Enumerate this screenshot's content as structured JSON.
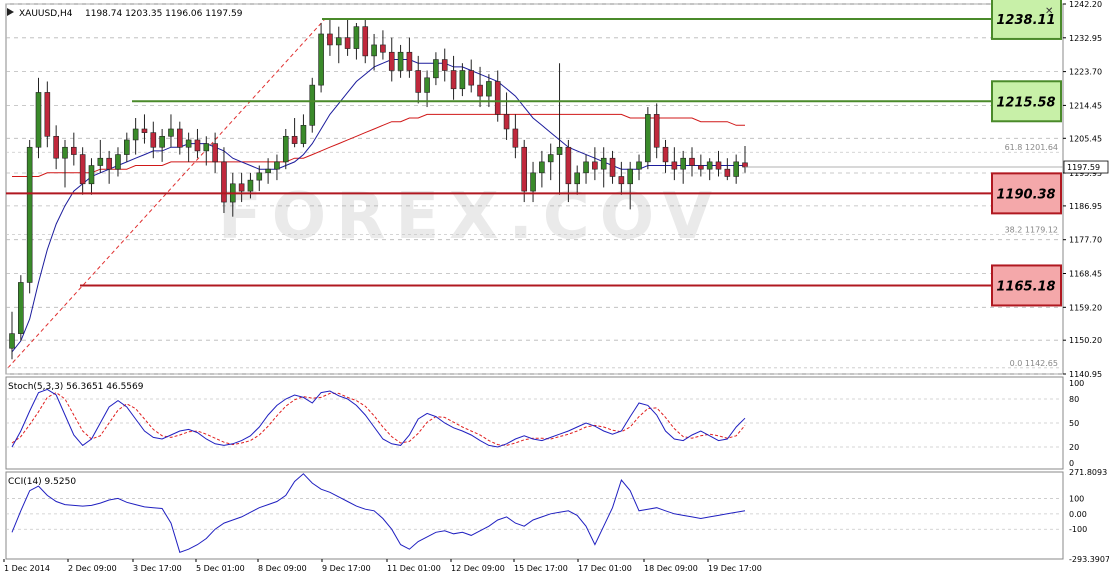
{
  "window": {
    "symbol_header": "XAUUSD,H4",
    "ohlc": "1198.74 1203.35 1196.06 1197.59",
    "close_button": "✕"
  },
  "watermark": "FOREX.COV",
  "price_axis": {
    "ticks": [
      "1242.20",
      "1232.95",
      "1223.70",
      "1214.45",
      "1205.45",
      "1195.95",
      "1186.95",
      "1177.70",
      "1168.45",
      "1159.20",
      "1150.20",
      "1140.95"
    ],
    "current_price": "1197.59"
  },
  "levels": [
    {
      "label": "1238.11",
      "value": 1238.11,
      "kind": "resistance"
    },
    {
      "label": "1215.58",
      "value": 1215.58,
      "kind": "resistance"
    },
    {
      "label": "1190.38",
      "value": 1190.38,
      "kind": "support"
    },
    {
      "label": "1165.18",
      "value": 1165.18,
      "kind": "support"
    }
  ],
  "fibo": [
    {
      "label": "61.8  1201.64",
      "value": 1201.64
    },
    {
      "label": "38.2  1179.12",
      "value": 1179.12
    },
    {
      "label": "0.0  1142.65",
      "value": 1142.65
    }
  ],
  "time_axis": [
    "1 Dec 2014",
    "2 Dec 09:00",
    "3 Dec 17:00",
    "5 Dec 01:00",
    "8 Dec 09:00",
    "9 Dec 17:00",
    "11 Dec 01:00",
    "12 Dec 09:00",
    "15 Dec 17:00",
    "17 Dec 01:00",
    "18 Dec 09:00",
    "19 Dec 17:00"
  ],
  "stoch": {
    "label": "Stoch(5,3,3) 56.3651 46.5569",
    "ticks": [
      "100",
      "80",
      "50",
      "20",
      "0"
    ]
  },
  "cci": {
    "label": "CCI(14) 9.5250",
    "ticks": [
      "271.8093",
      "100",
      "0.00",
      "-100",
      "-293.3907"
    ]
  },
  "colors": {
    "bull": "#3a8a2a",
    "bear": "#c0283c",
    "ma_fast": "#1c1c9c",
    "ma_slow": "#d01818",
    "resistance_line": "#4a8a2a",
    "resistance_fill": "#c8f0a8",
    "support_line": "#b01820",
    "support_fill": "#f4a8aa",
    "osc": "#2020c0",
    "signal": "#e02020"
  },
  "chart_data": {
    "type": "candlestick",
    "title": "XAUUSD,H4",
    "ylim": [
      1140.95,
      1242.2
    ],
    "candles": [
      [
        1148,
        1158,
        1145,
        1152
      ],
      [
        1152,
        1168,
        1150,
        1166
      ],
      [
        1166,
        1205,
        1163,
        1203
      ],
      [
        1203,
        1222,
        1200,
        1218
      ],
      [
        1218,
        1221,
        1203,
        1206
      ],
      [
        1206,
        1209,
        1197,
        1200
      ],
      [
        1200,
        1205,
        1192,
        1203
      ],
      [
        1203,
        1207,
        1198,
        1201
      ],
      [
        1201,
        1203,
        1190,
        1193
      ],
      [
        1193,
        1200,
        1190,
        1198
      ],
      [
        1198,
        1205,
        1196,
        1200
      ],
      [
        1200,
        1202,
        1193,
        1197
      ],
      [
        1197,
        1203,
        1195,
        1201
      ],
      [
        1201,
        1207,
        1199,
        1205
      ],
      [
        1205,
        1211,
        1201,
        1208
      ],
      [
        1208,
        1212,
        1204,
        1207
      ],
      [
        1207,
        1210,
        1200,
        1203
      ],
      [
        1203,
        1208,
        1199,
        1206
      ],
      [
        1206,
        1212,
        1203,
        1208
      ],
      [
        1208,
        1210,
        1201,
        1203
      ],
      [
        1203,
        1207,
        1199,
        1205
      ],
      [
        1205,
        1208,
        1200,
        1202
      ],
      [
        1202,
        1206,
        1198,
        1204
      ],
      [
        1204,
        1207,
        1196,
        1199
      ],
      [
        1199,
        1203,
        1185,
        1188
      ],
      [
        1188,
        1196,
        1184,
        1193
      ],
      [
        1193,
        1196,
        1188,
        1191
      ],
      [
        1191,
        1196,
        1189,
        1194
      ],
      [
        1194,
        1198,
        1191,
        1196
      ],
      [
        1196,
        1200,
        1193,
        1197
      ],
      [
        1197,
        1201,
        1194,
        1199
      ],
      [
        1199,
        1208,
        1197,
        1206
      ],
      [
        1206,
        1211,
        1203,
        1204
      ],
      [
        1204,
        1212,
        1203,
        1209
      ],
      [
        1209,
        1222,
        1207,
        1220
      ],
      [
        1220,
        1237,
        1218,
        1234
      ],
      [
        1234,
        1238,
        1228,
        1231
      ],
      [
        1231,
        1236,
        1226,
        1233
      ],
      [
        1233,
        1238,
        1228,
        1230
      ],
      [
        1230,
        1237,
        1227,
        1236
      ],
      [
        1236,
        1238,
        1226,
        1228
      ],
      [
        1228,
        1234,
        1224,
        1231
      ],
      [
        1231,
        1235,
        1227,
        1229
      ],
      [
        1229,
        1233,
        1221,
        1224
      ],
      [
        1224,
        1231,
        1222,
        1229
      ],
      [
        1229,
        1233,
        1222,
        1224
      ],
      [
        1224,
        1228,
        1215,
        1218
      ],
      [
        1218,
        1224,
        1214,
        1222
      ],
      [
        1222,
        1229,
        1220,
        1227
      ],
      [
        1227,
        1230,
        1221,
        1224
      ],
      [
        1224,
        1228,
        1216,
        1219
      ],
      [
        1219,
        1226,
        1217,
        1224
      ],
      [
        1224,
        1227,
        1218,
        1220
      ],
      [
        1220,
        1225,
        1214,
        1217
      ],
      [
        1217,
        1223,
        1214,
        1221
      ],
      [
        1221,
        1224,
        1210,
        1212
      ],
      [
        1212,
        1218,
        1205,
        1208
      ],
      [
        1208,
        1212,
        1200,
        1203
      ],
      [
        1203,
        1205,
        1188,
        1191
      ],
      [
        1191,
        1199,
        1188,
        1196
      ],
      [
        1196,
        1202,
        1192,
        1199
      ],
      [
        1199,
        1204,
        1194,
        1201
      ],
      [
        1201,
        1226,
        1190,
        1203
      ],
      [
        1203,
        1205,
        1188,
        1193
      ],
      [
        1193,
        1198,
        1190,
        1196
      ],
      [
        1196,
        1201,
        1193,
        1199
      ],
      [
        1199,
        1203,
        1194,
        1197
      ],
      [
        1197,
        1203,
        1192,
        1200
      ],
      [
        1200,
        1202,
        1193,
        1195
      ],
      [
        1195,
        1199,
        1190,
        1193
      ],
      [
        1193,
        1199,
        1186,
        1197
      ],
      [
        1197,
        1201,
        1194,
        1199
      ],
      [
        1199,
        1214,
        1197,
        1212
      ],
      [
        1212,
        1215,
        1200,
        1203
      ],
      [
        1203,
        1205,
        1196,
        1199
      ],
      [
        1199,
        1203,
        1194,
        1197
      ],
      [
        1197,
        1202,
        1193,
        1200
      ],
      [
        1200,
        1203,
        1195,
        1198
      ],
      [
        1198,
        1201,
        1195,
        1197
      ],
      [
        1197,
        1200,
        1194,
        1199
      ],
      [
        1199,
        1202,
        1195,
        1197
      ],
      [
        1197,
        1200,
        1194,
        1195
      ],
      [
        1195,
        1201,
        1193,
        1199
      ],
      [
        1198.74,
        1203.35,
        1196.06,
        1197.59
      ]
    ],
    "ma_fast": [
      1147,
      1150,
      1156,
      1166,
      1175,
      1182,
      1187,
      1191,
      1193,
      1195,
      1196,
      1197,
      1198,
      1199,
      1200,
      1201,
      1202,
      1202,
      1203,
      1203,
      1204,
      1204,
      1204,
      1203,
      1202,
      1200,
      1199,
      1198,
      1197,
      1197,
      1197,
      1198,
      1199,
      1201,
      1204,
      1208,
      1212,
      1215,
      1218,
      1221,
      1223,
      1225,
      1226,
      1227,
      1227,
      1227,
      1226,
      1226,
      1226,
      1226,
      1225,
      1225,
      1224,
      1223,
      1222,
      1221,
      1219,
      1217,
      1214,
      1211,
      1209,
      1207,
      1205,
      1203,
      1202,
      1201,
      1200,
      1199,
      1198,
      1197,
      1197,
      1197,
      1198,
      1198,
      1198,
      1198,
      1198,
      1198,
      1198,
      1198,
      1198,
      1198,
      1198,
      1198
    ],
    "ma_slow": [
      1195,
      1195,
      1195,
      1195,
      1196,
      1196,
      1196,
      1196,
      1196,
      1196,
      1197,
      1197,
      1197,
      1197,
      1198,
      1198,
      1198,
      1198,
      1199,
      1199,
      1199,
      1199,
      1199,
      1199,
      1199,
      1199,
      1199,
      1199,
      1199,
      1199,
      1199,
      1199,
      1200,
      1200,
      1201,
      1202,
      1203,
      1204,
      1205,
      1206,
      1207,
      1208,
      1209,
      1210,
      1210,
      1211,
      1211,
      1212,
      1212,
      1212,
      1212,
      1212,
      1212,
      1212,
      1212,
      1212,
      1212,
      1212,
      1212,
      1212,
      1212,
      1212,
      1212,
      1212,
      1212,
      1212,
      1212,
      1212,
      1212,
      1212,
      1211,
      1211,
      1211,
      1211,
      1211,
      1211,
      1211,
      1211,
      1210,
      1210,
      1210,
      1210,
      1209,
      1209
    ],
    "stoch_main": [
      20,
      40,
      65,
      88,
      92,
      85,
      60,
      35,
      22,
      30,
      50,
      70,
      78,
      70,
      55,
      40,
      32,
      30,
      35,
      40,
      42,
      38,
      30,
      24,
      22,
      24,
      28,
      34,
      45,
      60,
      72,
      80,
      85,
      82,
      75,
      88,
      90,
      84,
      80,
      72,
      60,
      45,
      30,
      24,
      22,
      35,
      55,
      62,
      58,
      50,
      44,
      40,
      35,
      28,
      22,
      20,
      24,
      30,
      34,
      30,
      28,
      32,
      36,
      40,
      45,
      50,
      46,
      40,
      36,
      40,
      58,
      75,
      72,
      60,
      40,
      30,
      28,
      35,
      40,
      34,
      28,
      30,
      45,
      56
    ],
    "stoch_signal": [
      25,
      33,
      48,
      64,
      82,
      88,
      80,
      60,
      40,
      30,
      34,
      50,
      66,
      74,
      68,
      55,
      42,
      34,
      32,
      35,
      39,
      40,
      36,
      31,
      26,
      23,
      25,
      28,
      35,
      46,
      59,
      71,
      79,
      83,
      81,
      82,
      87,
      87,
      82,
      78,
      71,
      59,
      45,
      33,
      25,
      27,
      37,
      51,
      58,
      57,
      51,
      45,
      40,
      35,
      28,
      23,
      22,
      25,
      29,
      31,
      31,
      30,
      33,
      36,
      40,
      45,
      47,
      45,
      41,
      39,
      45,
      58,
      68,
      69,
      57,
      43,
      33,
      31,
      34,
      36,
      34,
      31,
      34,
      47
    ],
    "cci": [
      -120,
      20,
      150,
      180,
      120,
      80,
      60,
      55,
      50,
      55,
      70,
      90,
      100,
      75,
      60,
      45,
      40,
      35,
      -60,
      -250,
      -230,
      -200,
      -160,
      -100,
      -60,
      -40,
      -20,
      10,
      40,
      60,
      80,
      120,
      210,
      260,
      200,
      160,
      140,
      110,
      80,
      50,
      30,
      20,
      -30,
      -100,
      -200,
      -230,
      -180,
      -150,
      -120,
      -110,
      -130,
      -120,
      -140,
      -110,
      -80,
      -40,
      -20,
      -60,
      -80,
      -40,
      -20,
      0,
      10,
      20,
      -10,
      -80,
      -200,
      -80,
      40,
      220,
      150,
      20,
      30,
      40,
      20,
      0,
      -10,
      -20,
      -30,
      -20,
      -10,
      0,
      10,
      20
    ]
  }
}
